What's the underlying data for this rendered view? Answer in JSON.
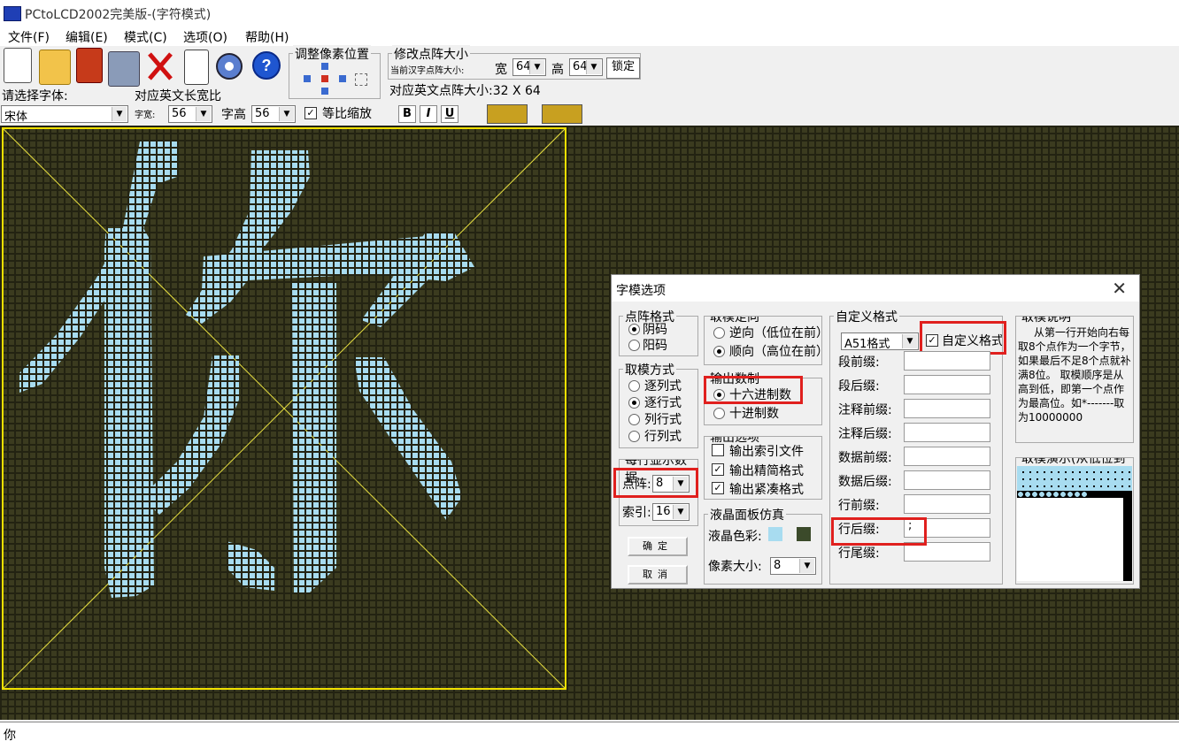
{
  "window": {
    "title": "PCtoLCD2002完美版-(字符模式)"
  },
  "menu": [
    "文件(F)",
    "编辑(E)",
    "模式(C)",
    "选项(O)",
    "帮助(H)"
  ],
  "toolbar": {
    "adjust_pixel_label": "调整像素位置",
    "modify_matrix_label": "修改点阵大小",
    "current_size_label": "当前汉字点阵大小:",
    "width_label": "宽",
    "width_value": "64",
    "height_label": "高",
    "height_value": "64",
    "lock_label": "锁定",
    "eng_size_label": "对应英文点阵大小:32 X 64",
    "font_select_label": "请选择字体:",
    "font_value": "宋体",
    "eng_ratio_label": "对应英文长宽比",
    "char_width_label": "字宽:",
    "char_width_value": "56",
    "char_height_label": "字高",
    "char_height_value": "56",
    "proportional_label": "等比缩放",
    "bold_label": "B",
    "italic_label": "I",
    "underline_label": "U"
  },
  "canvas": {
    "glyph_color": "#a8dcf0",
    "background_color": "#3b3b1f",
    "char_box_color": "#f0e000"
  },
  "status": {
    "text": "你"
  },
  "dialog": {
    "title": "字模选项",
    "close": "✕",
    "dot_format": {
      "title": "点阵格式",
      "options": [
        "阴码",
        "阳码"
      ],
      "selected": 0
    },
    "scan_mode": {
      "title": "取模方式",
      "options": [
        "逐列式",
        "逐行式",
        "列行式",
        "行列式"
      ],
      "selected": 1
    },
    "per_line": {
      "title": "每行显示数据",
      "matrix_label": "点阵:",
      "matrix_value": "8",
      "index_label": "索引:",
      "index_value": "16"
    },
    "ok_label": "确定",
    "cancel_label": "取消",
    "direction": {
      "title": "取模走向",
      "options": [
        "逆向（低位在前）",
        "顺向（高位在前）"
      ],
      "selected": 1
    },
    "number_base": {
      "title": "输出数制",
      "options": [
        "十六进制数",
        "十进制数"
      ],
      "selected": 0
    },
    "output_options": {
      "title": "输出选项",
      "items": [
        {
          "label": "输出索引文件",
          "checked": false
        },
        {
          "label": "输出精简格式",
          "checked": true
        },
        {
          "label": "输出紧凑格式",
          "checked": true
        }
      ]
    },
    "lcd_sim": {
      "title": "液晶面板仿真",
      "color_label": "液晶色彩:",
      "color_fg": "#a8dcf0",
      "color_bg": "#3b4a2a",
      "pixel_label": "像素大小:",
      "pixel_value": "8"
    },
    "custom_format": {
      "title": "自定义格式",
      "format_value": "A51格式",
      "custom_label": "自定义格式",
      "custom_checked": true,
      "fields": [
        {
          "label": "段前缀:",
          "value": ""
        },
        {
          "label": "段后缀:",
          "value": ""
        },
        {
          "label": "注释前缀:",
          "value": ""
        },
        {
          "label": "注释后缀:",
          "value": ""
        },
        {
          "label": "数据前缀:",
          "value": ""
        },
        {
          "label": "数据后缀:",
          "value": ""
        },
        {
          "label": "行前缀:",
          "value": ""
        },
        {
          "label": "行后缀:",
          "value": ";"
        },
        {
          "label": "行尾缀:",
          "value": ""
        }
      ]
    },
    "explain": {
      "title": "取模说明",
      "text": "从第一行开始向右每取8个点作为一个字节，如果最后不足8个点就补满8位。 取模顺序是从高到低，即第一个点作为最高位。如*-------取为10000000"
    },
    "demo": {
      "title": "取模演示(从低位到高位)"
    }
  }
}
